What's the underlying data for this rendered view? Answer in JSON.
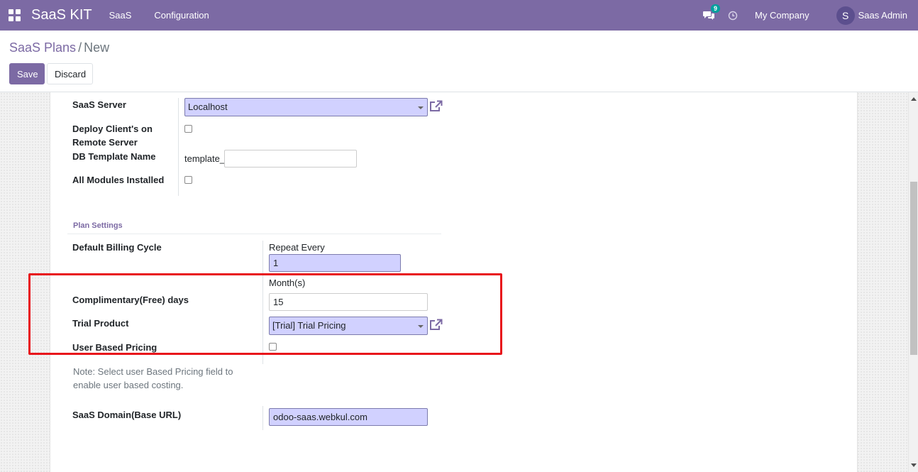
{
  "navbar": {
    "brand": "SaaS KIT",
    "menu": [
      "SaaS",
      "Configuration"
    ],
    "chat_badge": "9",
    "company": "My Company",
    "user_initial": "S",
    "user_name": "Saas Admin",
    "color": "#7c6aa4"
  },
  "breadcrumb": {
    "parent": "SaaS Plans",
    "separator": "/",
    "current": "New"
  },
  "buttons": {
    "save": "Save",
    "discard": "Discard"
  },
  "form": {
    "saas_server": {
      "label": "SaaS Server",
      "value": "Localhost"
    },
    "deploy_remote": {
      "label_line1": "Deploy Client's on",
      "label_line2": "Remote Server",
      "checked": false
    },
    "db_template": {
      "label": "DB Template Name",
      "prefix": "template_",
      "value": ""
    },
    "all_modules": {
      "label": "All Modules Installed",
      "checked": false
    },
    "plan_settings_title": "Plan Settings",
    "billing_cycle": {
      "label": "Default Billing Cycle",
      "repeat_label": "Repeat Every",
      "value": "1",
      "unit": "Month(s)"
    },
    "free_days": {
      "label": "Complimentary(Free) days",
      "value": "15"
    },
    "trial_product": {
      "label": "Trial Product",
      "value": "[Trial] Trial Pricing"
    },
    "user_pricing": {
      "label": "User Based Pricing",
      "checked": false
    },
    "note_line1": "Note: Select user Based Pricing field to",
    "note_line2": "enable user based costing.",
    "saas_domain": {
      "label": "SaaS Domain(Base URL)",
      "value": "odoo-saas.webkul.com"
    }
  },
  "colors": {
    "required_field_bg": "#d1d1ff",
    "highlight_border": "#e8141b"
  }
}
